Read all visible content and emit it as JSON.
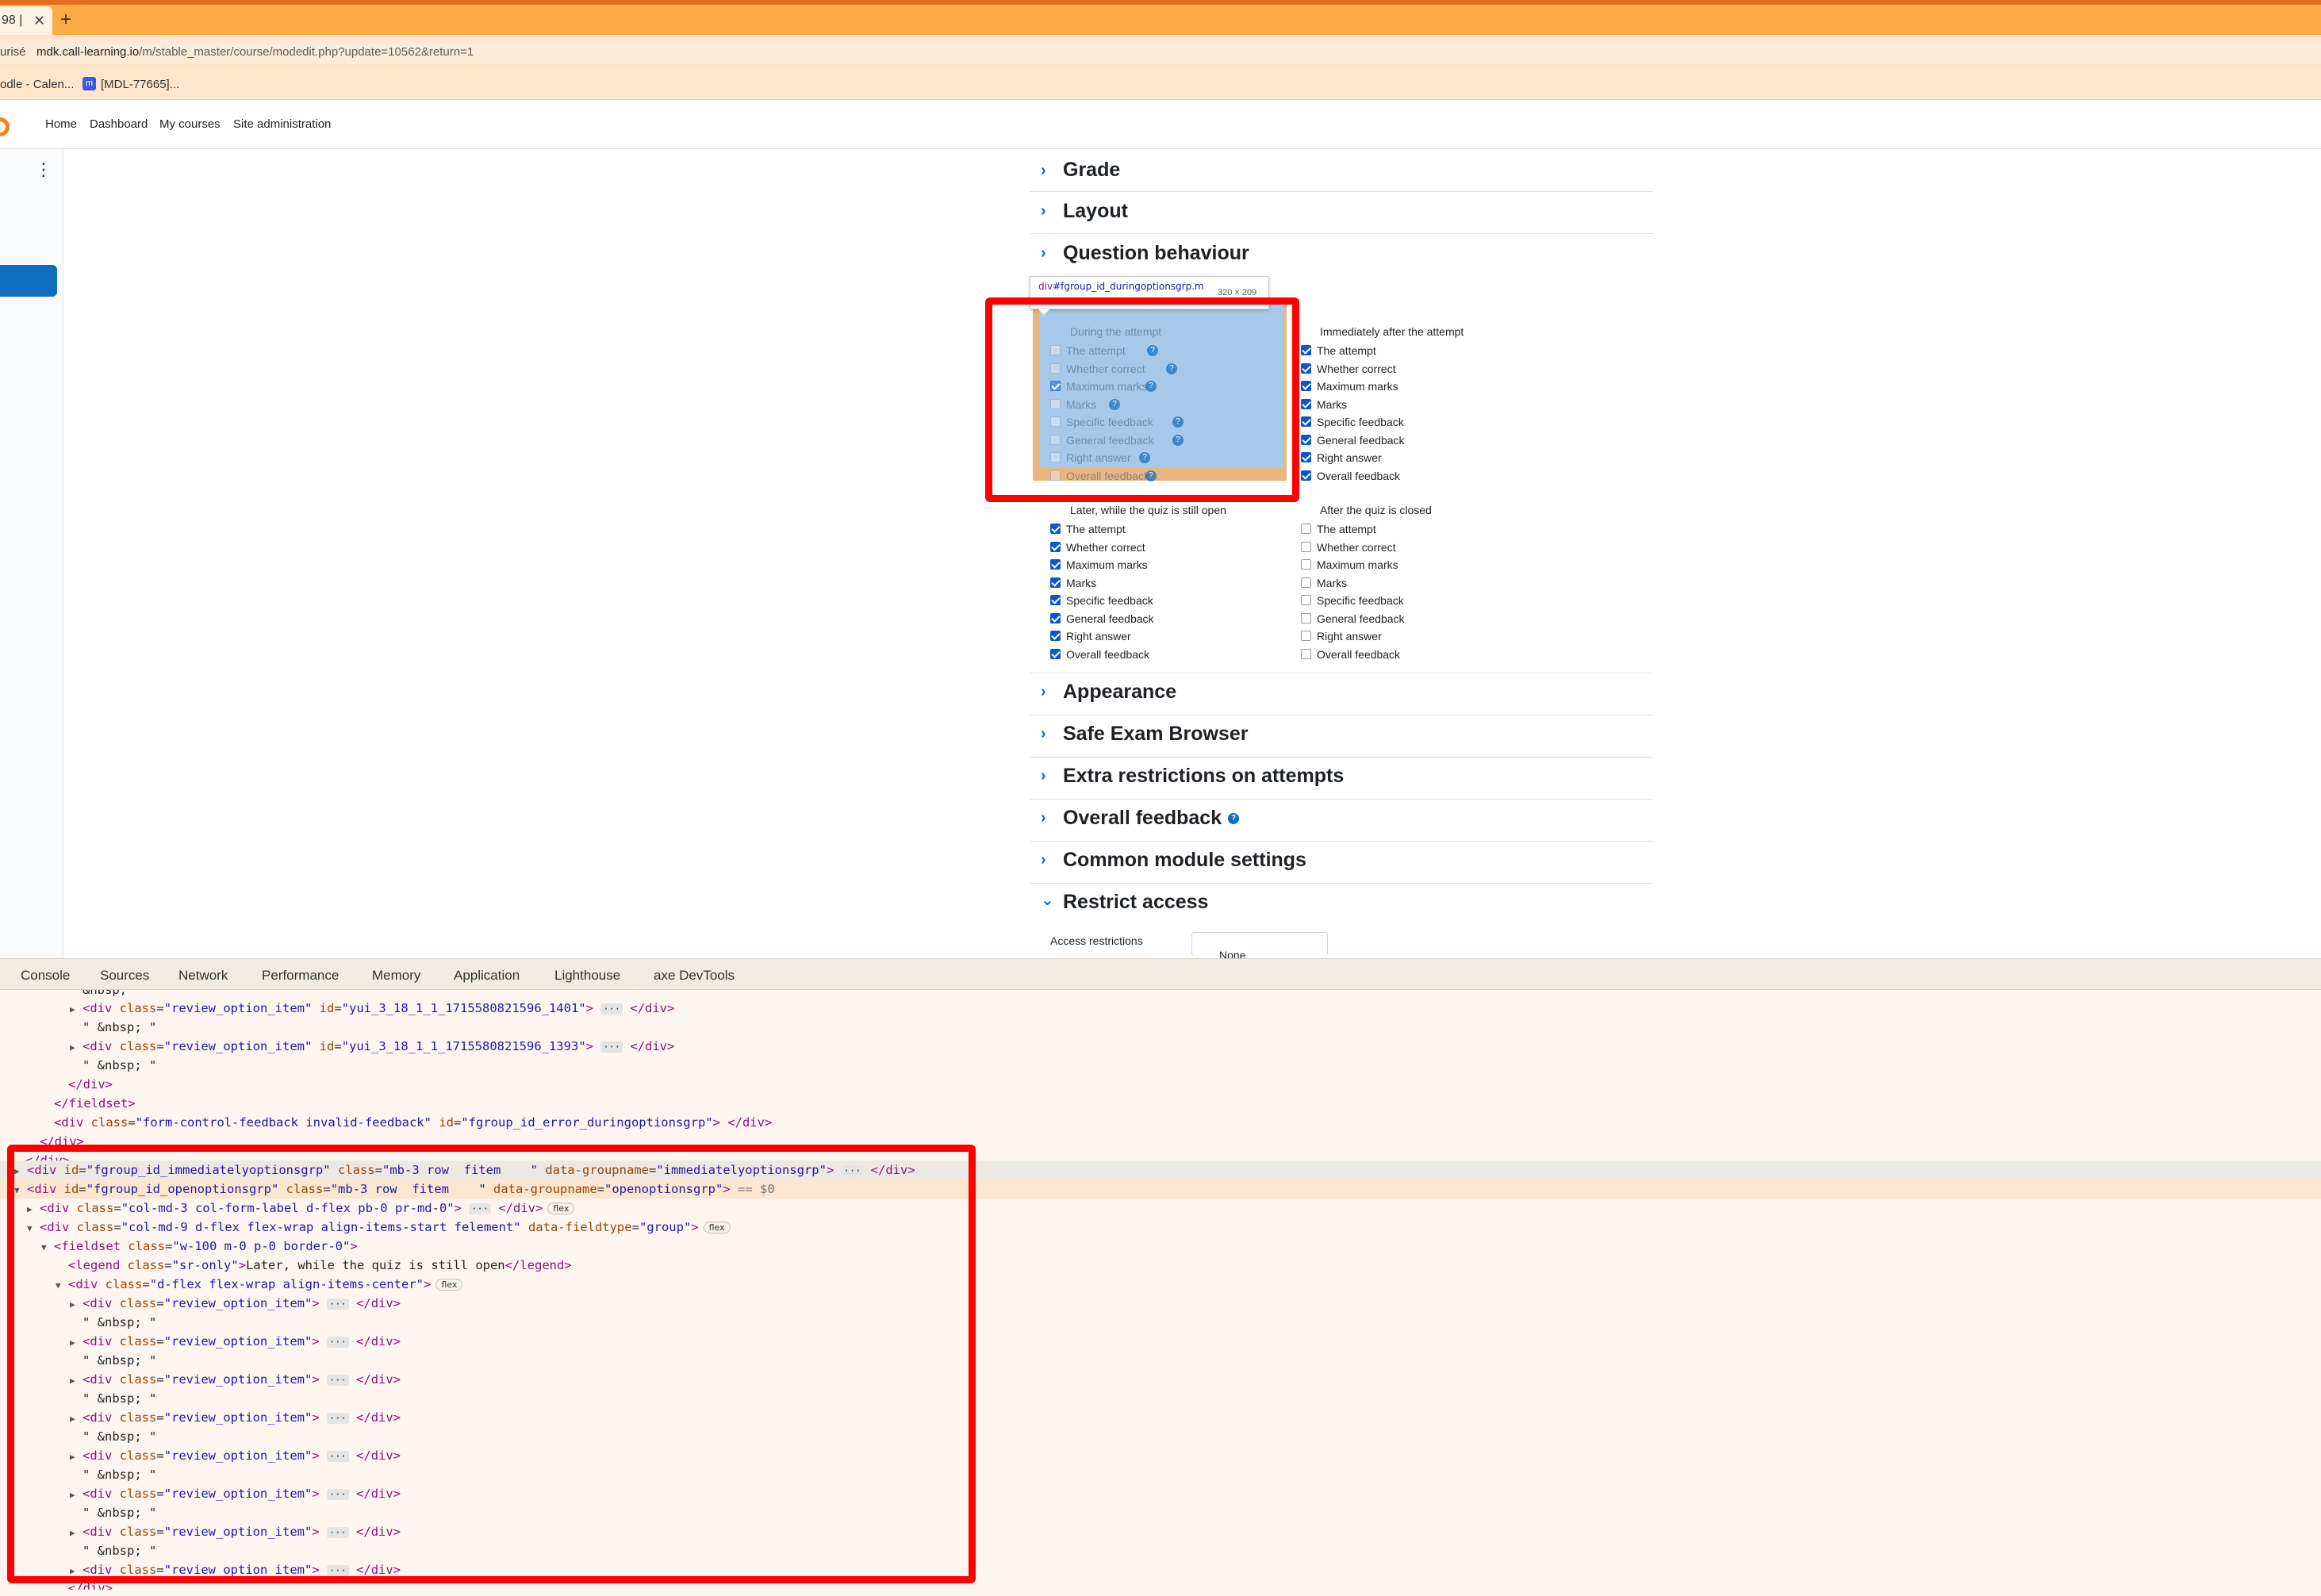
{
  "browser": {
    "tab_title": "98 |",
    "tab_close": "✕",
    "new_tab": "+",
    "url_left": "urisé",
    "url_host": "mdk.call-learning.io",
    "url_path": "/m/stable_master/course/modedit.php?update=10562&return=1",
    "bookmark_1": "odle - Calen...",
    "bookmark_2": "[MDL-77665]...",
    "bookmark_2_icon": "m"
  },
  "navbar": {
    "links": [
      "Home",
      "Dashboard",
      "My courses",
      "Site administration"
    ]
  },
  "sections": {
    "grade": "Grade",
    "layout": "Layout",
    "question_behaviour": "Question behaviour",
    "appearance": "Appearance",
    "safe_exam": "Safe Exam Browser",
    "extra": "Extra restrictions on attempts",
    "overall_feedback": "Overall feedback",
    "common": "Common module settings",
    "restrict": "Restrict access",
    "chevron_right": "›",
    "chevron_down": "⌄",
    "help": "?"
  },
  "inspector_tooltip": {
    "selector_tag": "div",
    "selector_id": "#fgroup_id_duringoptionsgrp.m",
    "size": "320 × 209"
  },
  "review_options": {
    "items": [
      "The attempt",
      "Whether correct",
      "Maximum marks",
      "Marks",
      "Specific feedback",
      "General feedback",
      "Right answer",
      "Overall feedback"
    ],
    "groups": [
      {
        "heading": "During the attempt",
        "checked": [
          false,
          false,
          true,
          false,
          false,
          false,
          false,
          false
        ]
      },
      {
        "heading": "Immediately after the attempt",
        "checked": [
          true,
          true,
          true,
          true,
          true,
          true,
          true,
          true
        ]
      },
      {
        "heading": "Later, while the quiz is still open",
        "checked": [
          true,
          true,
          true,
          true,
          true,
          true,
          true,
          true
        ]
      },
      {
        "heading": "After the quiz is closed",
        "checked": [
          false,
          false,
          false,
          false,
          false,
          false,
          false,
          false
        ]
      }
    ]
  },
  "restrict_access": {
    "label": "Access restrictions",
    "value": "None"
  },
  "devtools": {
    "tabs": [
      "Console",
      "Sources",
      "Network",
      "Performance",
      "Memory",
      "Application",
      "Lighthouse",
      "axe DevTools"
    ]
  },
  "code": {
    "nbsp_first": "&nbsp; \"",
    "nbsp": "\" &nbsp; \"",
    "div_open": "<div",
    "div_close_tag": "</div>",
    "div_close_line": "</div>",
    "fieldset_close": "</fieldset>",
    "ellipsis": "···",
    "class_attr": "class",
    "id_attr": "id",
    "review_item_class": "\"review_option_item\"",
    "yui_id_1": "\"yui_3_18_1_1_1715580821596_1401\"",
    "yui_id_2": "\"yui_3_18_1_1_1715580821596_1393\"",
    "feedback_open": "<div",
    "feedback_class": "\"form-control-feedback invalid-feedback\"",
    "feedback_id": "\"fgroup_id_error_duringoptionsgrp\"",
    "trailing_close": "</div>",
    "immediate_id": "\"fgroup_id_immediatelyoptionsgrp\"",
    "immediate_class": "\"mb-3 row  fitem    \"",
    "groupname_attr": "data-groupname",
    "immediate_groupname": "\"immediatelyoptionsgrp\"",
    "open_id": "\"fgroup_id_openoptionsgrp\"",
    "open_class": "\"mb-3 row  fitem    \"",
    "open_groupname": "\"openoptionsgrp\"",
    "selected_marker": "== $0",
    "label_col_class": "\"col-md-3 col-form-label d-flex pb-0 pr-md-0\"",
    "felement_class": "\"col-md-9 d-flex flex-wrap align-items-start felement\"",
    "fieldtype_attr": "data-fieldtype",
    "fieldtype_val": "\"group\"",
    "flex_badge": "flex",
    "fieldset_open": "<fieldset",
    "fieldset_class": "\"w-100 m-0 p-0 border-0\"",
    "legend_open": "<legend",
    "legend_class": "\"sr-only\"",
    "legend_text": "Later, while the quiz is still open",
    "legend_close": "</legend>",
    "flexwrap_class": "\"d-flex flex-wrap align-items-center\""
  },
  "colors": {
    "tab_strip": "#fbaa45",
    "moodle_primary": "#0f6cbf",
    "checkbox_checked": "#0b57d0",
    "annotation_red": "#ff0000",
    "devtools_bg": "#fff5f0"
  }
}
